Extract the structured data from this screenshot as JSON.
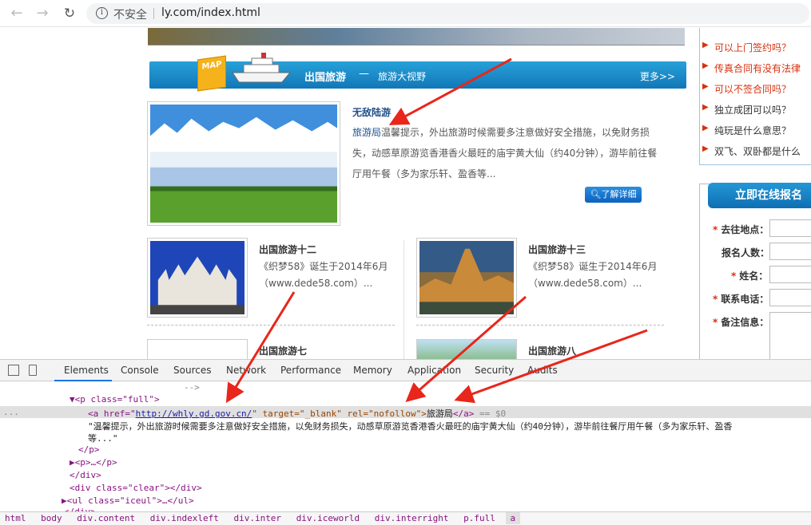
{
  "browser": {
    "insecure_label": "不安全",
    "url": "ly.com/index.html"
  },
  "section": {
    "title": "出国旅游",
    "dash": "—",
    "subtitle": "旅游大视野",
    "more": "更多>>",
    "map_badge": "MAP"
  },
  "feature": {
    "title": "无敌陆游",
    "link_text": "旅游局",
    "text": "温馨提示，外出旅游时候需要多注意做好安全措施，以免财务损失，动感草原游览香港香火最旺的庙宇黄大仙（约40分钟），游毕前往餐厅用午餐（多为家乐轩、盈香等...",
    "button": "了解详细",
    "button_icon": "search-icon"
  },
  "cards": [
    {
      "title": "出国旅游十二",
      "text": "《织梦58》诞生于2014年6月（www.dede58.com）..."
    },
    {
      "title": "出国旅游十三",
      "text": "《织梦58》诞生于2014年6月（www.dede58.com）..."
    },
    {
      "title": "出国旅游七",
      "text": ""
    },
    {
      "title": "出国旅游八",
      "text": ""
    }
  ],
  "faq": [
    {
      "label": "可以上门签约吗？",
      "color": "#d8300e"
    },
    {
      "label": "传真合同有没有法律",
      "color": "#d8300e"
    },
    {
      "label": "可以不签合同吗？",
      "color": "#d8300e"
    },
    {
      "label": "独立成团可以吗？",
      "color": "#333333"
    },
    {
      "label": "纯玩是什么意思？",
      "color": "#333333"
    },
    {
      "label": "双飞、双卧都是什么",
      "color": "#333333"
    }
  ],
  "signup": {
    "title": "立即在线报名",
    "fields": [
      {
        "label": "去往地点：",
        "required": true
      },
      {
        "label": "报名人数：",
        "required": false
      },
      {
        "label": "姓名：",
        "required": true
      },
      {
        "label": "联系电话：",
        "required": true
      },
      {
        "label": "备注信息：",
        "required": true
      }
    ]
  },
  "devtools": {
    "tabs": [
      "Elements",
      "Console",
      "Sources",
      "Network",
      "Performance",
      "Memory",
      "Application",
      "Security",
      "Audits"
    ],
    "active_tab": "Elements",
    "lines": {
      "l0": "-->",
      "l1": "▼<p class=\"full\">",
      "l2_open": "<a href=\"",
      "l2_href": "http://whly.gd.gov.cn/",
      "l2_rest": "\" target=\"_blank\" rel=\"nofollow\">",
      "l2_text": "旅游局",
      "l2_close": "</a>",
      "l2_eq": " == $0",
      "l2_dots": "...",
      "l3": "\"温馨提示，外出旅游时候需要多注意做好安全措施，以免财务损失，动感草原游览香港香火最旺的庙宇黄大仙（约40分钟），游毕前往餐厅用午餐（多为家乐轩、盈香",
      "l4": "等...\"",
      "l5": "</p>",
      "l6": "▶<p>…</p>",
      "l7": "</div>",
      "l8": "<div class=\"clear\"></div>",
      "l9": "▶<ul class=\"iceul\">…</ul>",
      "l10": "</div>"
    },
    "breadcrumbs": [
      "html",
      "body",
      "div.content",
      "div.indexleft",
      "div.inter",
      "div.iceworld",
      "div.interright",
      "p.full",
      "a"
    ]
  }
}
